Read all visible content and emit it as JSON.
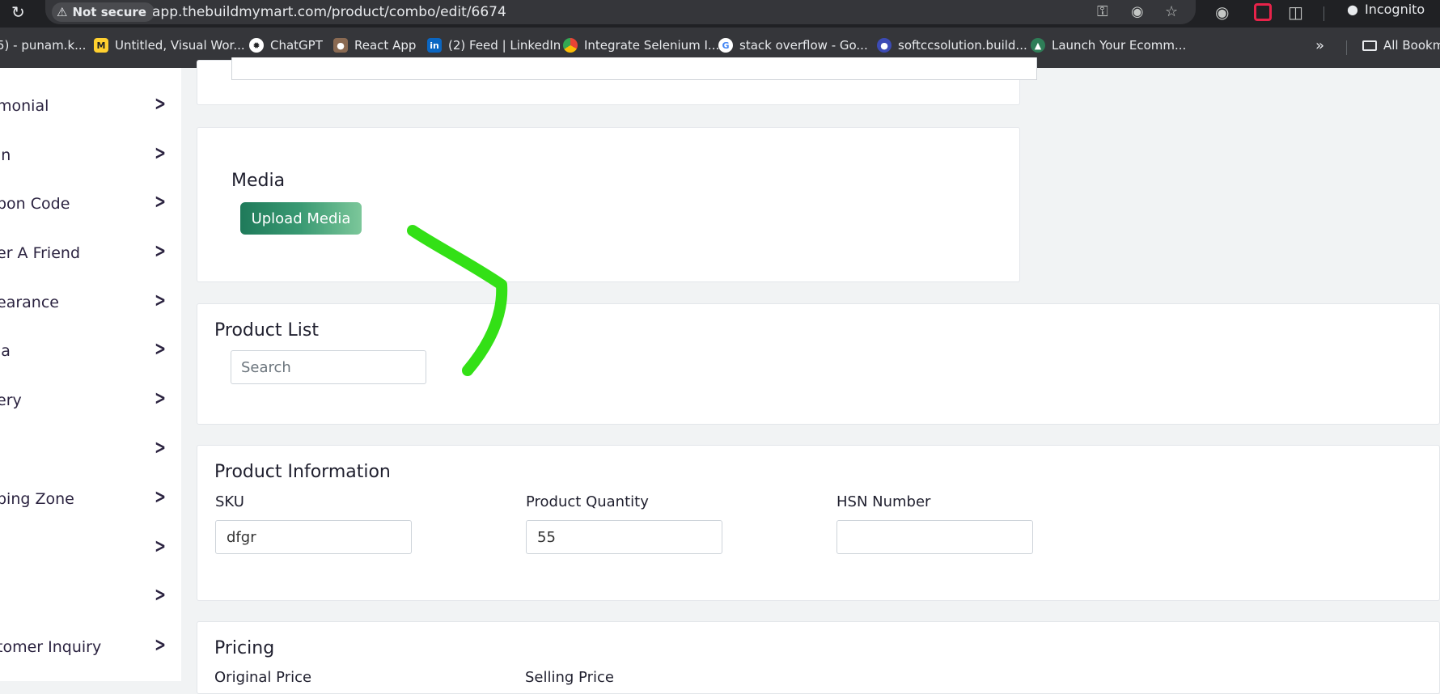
{
  "browser": {
    "security_label": "Not secure",
    "url": "app.thebuildmymart.com/product/combo/edit/6674",
    "incognito_label": "Incognito"
  },
  "bookmarks": [
    {
      "label": "5) - punam.k...",
      "icon": "user-icon",
      "color": "#5f6368"
    },
    {
      "label": "Untitled, Visual Wor...",
      "icon": "miro-icon",
      "color": "#ffd02f"
    },
    {
      "label": "ChatGPT",
      "icon": "chatgpt-icon",
      "color": "#ffffff"
    },
    {
      "label": "React App",
      "icon": "react-app-icon",
      "color": "#8a6a52"
    },
    {
      "label": "(2) Feed | LinkedIn",
      "icon": "linkedin-icon",
      "color": "#0a66c2"
    },
    {
      "label": "Integrate Selenium I...",
      "icon": "chrome-icon",
      "color": "#f28b82"
    },
    {
      "label": "stack overflow - Go...",
      "icon": "google-icon",
      "color": "#ffffff"
    },
    {
      "label": "softccsolution.build...",
      "icon": "site-icon",
      "color": "#3c4bb5"
    },
    {
      "label": "Launch Your Ecomm...",
      "icon": "ecommerce-icon",
      "color": "#2e7d57"
    }
  ],
  "all_bookmarks_label": "All Bookm",
  "sidebar": {
    "items": [
      {
        "label": "monial"
      },
      {
        "label": "in"
      },
      {
        "label": "pon Code"
      },
      {
        "label": "er A Friend"
      },
      {
        "label": "earance"
      },
      {
        "label": "ia"
      },
      {
        "label": "ery"
      },
      {
        "label": ""
      },
      {
        "label": "ping Zone"
      },
      {
        "label": ""
      },
      {
        "label": ""
      },
      {
        "label": "tomer Inquiry"
      }
    ]
  },
  "media": {
    "title": "Media",
    "upload_label": "Upload Media"
  },
  "product_list": {
    "title": "Product List",
    "search_placeholder": "Search"
  },
  "product_info": {
    "title": "Product Information",
    "sku_label": "SKU",
    "sku_value": "dfgr",
    "quantity_label": "Product Quantity",
    "quantity_value": "55",
    "hsn_label": "HSN Number",
    "hsn_value": ""
  },
  "pricing": {
    "title": "Pricing",
    "original_price_label": "Original Price",
    "selling_price_label": "Selling Price"
  },
  "colors": {
    "accent_green": "#2b8a63",
    "annotation_green": "#33e016"
  }
}
